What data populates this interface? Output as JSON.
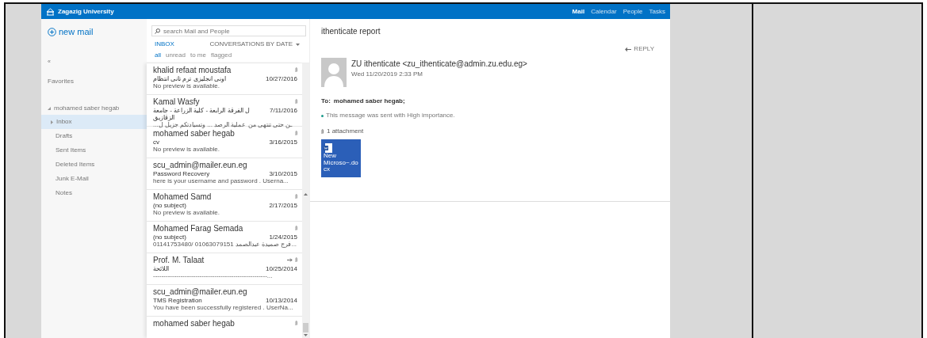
{
  "header": {
    "brand": "Zagazig University",
    "apps": [
      {
        "label": "Mail",
        "selected": true
      },
      {
        "label": "Calendar",
        "selected": false
      },
      {
        "label": "People",
        "selected": false
      },
      {
        "label": "Tasks",
        "selected": false
      }
    ]
  },
  "nav": {
    "new_mail": "new mail",
    "collapse": "«",
    "favorites": "Favorites",
    "account": {
      "label": "mohamed saber hegab",
      "expanded": true
    },
    "folders": [
      {
        "label": "Inbox",
        "selected": true,
        "expandable": true
      },
      {
        "label": "Drafts",
        "selected": false,
        "expandable": false
      },
      {
        "label": "Sent Items",
        "selected": false,
        "expandable": false
      },
      {
        "label": "Deleted Items",
        "selected": false,
        "expandable": false
      },
      {
        "label": "Junk E-Mail",
        "selected": false,
        "expandable": false
      },
      {
        "label": "Notes",
        "selected": false,
        "expandable": false
      }
    ]
  },
  "list": {
    "search": {
      "placeholder": "search Mail and People"
    },
    "folder": "INBOX",
    "sort": "CONVERSATIONS BY DATE",
    "filters": [
      {
        "label": "all",
        "selected": true
      },
      {
        "label": "unread",
        "selected": false
      },
      {
        "label": "to me",
        "selected": false
      },
      {
        "label": "flagged",
        "selected": false
      }
    ],
    "messages": [
      {
        "sender": "khalid refaat moustafa",
        "subject": "اونى انجليزى ترم تانى انتظام",
        "date": "10/27/2016",
        "preview": "No preview is available.",
        "attachment": true,
        "forwarded": false
      },
      {
        "sender": "Kamal Wasfy",
        "subject": "ل الفرقة الرابعة - كلية الزراعة - جامعة الزقازيق",
        "date": "7/11/2016",
        "preview": "...ـن حتى تنتهى من عملية الرصد ... وتسيادتكم جزيل ل",
        "attachment": true,
        "forwarded": false
      },
      {
        "sender": "mohamed saber hegab",
        "subject": "cv",
        "date": "3/16/2015",
        "preview": "No preview is available.",
        "attachment": true,
        "forwarded": false
      },
      {
        "sender": "scu_admin@mailer.eun.eg",
        "subject": "Password Recovery",
        "date": "3/10/2015",
        "preview": "here is your username and password . Userna...",
        "attachment": false,
        "forwarded": false
      },
      {
        "sender": "Mohamed Samd",
        "subject": "(no subject)",
        "date": "2/17/2015",
        "preview": "No preview is available.",
        "attachment": true,
        "forwarded": false
      },
      {
        "sender": "Mohamed Farag Semada",
        "subject": "(no subject)",
        "date": "1/24/2015",
        "preview": "01141753480/ 01063079151 فرج صميدة عبدالصمد...",
        "attachment": true,
        "forwarded": false
      },
      {
        "sender": "Prof. M. Talaat",
        "subject": "اللائحة",
        "date": "10/25/2014",
        "preview": "------------------------------------------------------...",
        "attachment": true,
        "forwarded": true
      },
      {
        "sender": "scu_admin@mailer.eun.eg",
        "subject": "TMS Registration",
        "date": "10/13/2014",
        "preview": "You have been successfully registered . UserNa...",
        "attachment": false,
        "forwarded": false
      },
      {
        "sender": "mohamed saber hegab",
        "attachment": true,
        "forwarded": false
      }
    ]
  },
  "reading": {
    "title": "ithenticate report",
    "reply": "REPLY",
    "from": "ZU ithenticate <zu_ithenticate@admin.zu.edu.eg>",
    "sent": "Wed 11/20/2019 2:33 PM",
    "to_label": "To:",
    "to": "mohamed saber hegab;",
    "importance": "This message was sent with High importance.",
    "attachments_label": "1 attachment",
    "attachment_name": "New Microso~.do cx"
  }
}
